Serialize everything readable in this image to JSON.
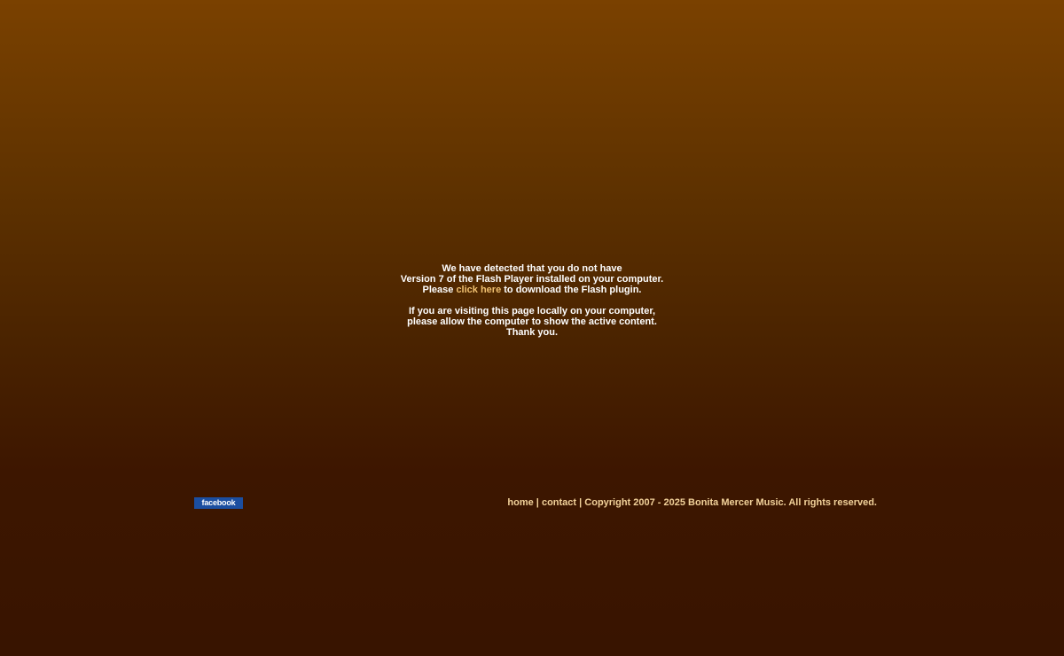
{
  "notice": {
    "line1": "We have detected that you do not have",
    "line2": "Version 7 of the Flash Player installed on your computer.",
    "line3_pre": "Please ",
    "line3_link": "click here",
    "line3_post": " to download the Flash plugin.",
    "line4": "If you are visiting this page locally on your computer,",
    "line5": "please allow the computer to show the active content.",
    "line6": "Thank you."
  },
  "social": {
    "facebook_label": "facebook",
    "facebook_color": "#1b4ea0"
  },
  "footer": {
    "home_label": "home",
    "separator1": " | ",
    "contact_label": "contact",
    "separator2": " | ",
    "copyright": "Copyright 2007 - 2025 Bonita Mercer Music. All rights reserved."
  },
  "colors": {
    "link": "#f0c070",
    "footer_text": "#f2d29a",
    "background_top": "#7a4100",
    "background_bottom": "#381400"
  }
}
